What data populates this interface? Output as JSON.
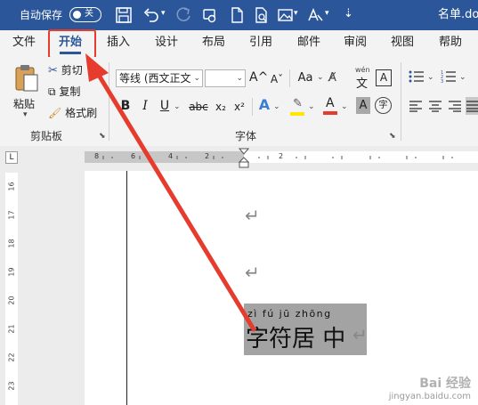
{
  "title_bar": {
    "autosave_label": "自动保存",
    "autosave_state": "关",
    "doc_title": "名单.doc",
    "icons": [
      "save-icon",
      "undo-icon",
      "redo-icon",
      "touch-mode-icon",
      "new-document-icon",
      "print-preview-icon",
      "image-icon",
      "text-style-icon"
    ]
  },
  "tabs": [
    "文件",
    "开始",
    "插入",
    "设计",
    "布局",
    "引用",
    "邮件",
    "审阅",
    "视图",
    "帮助"
  ],
  "active_tab": "开始",
  "clipboard": {
    "paste_label": "粘贴",
    "cut_label": "剪切",
    "copy_label": "复制",
    "format_painter_label": "格式刷",
    "group_label": "剪贴板"
  },
  "font": {
    "font_name": "等线 (西文正文",
    "font_size": "",
    "grow_label": "A^",
    "shrink_label": "Aˇ",
    "change_case_label": "Aa",
    "pinyin_guide_label": "wén",
    "pinyin_guide_char": "文",
    "char_border_label": "A",
    "bold": "B",
    "italic": "I",
    "underline": "U",
    "strikethrough": "abc",
    "subscript": "x₂",
    "superscript": "x²",
    "text_effects": "A",
    "highlight": "A",
    "font_color": "A",
    "char_shading": "A",
    "enclosed_char": "字",
    "group_label": "字体"
  },
  "ruler": {
    "corner_label": "L",
    "numbers": [
      "8",
      "6",
      "4",
      "2",
      "2"
    ]
  },
  "vertical_ruler": [
    "16",
    "17",
    "18",
    "19",
    "20",
    "21",
    "22",
    "23"
  ],
  "document": {
    "paragraph_mark": "↵",
    "pinyin": "zì fú jū zhōng",
    "selected_text": "字符居 中"
  },
  "watermark": {
    "line1": "Bai 经验",
    "line2": "jingyan.baidu.com"
  },
  "colors": {
    "title_bar": "#2b579a",
    "active_tab": "#2b579a",
    "annotation_red": "#e53c2e",
    "highlight_yellow": "#ffe600",
    "font_color_red": "#e53c2e"
  }
}
